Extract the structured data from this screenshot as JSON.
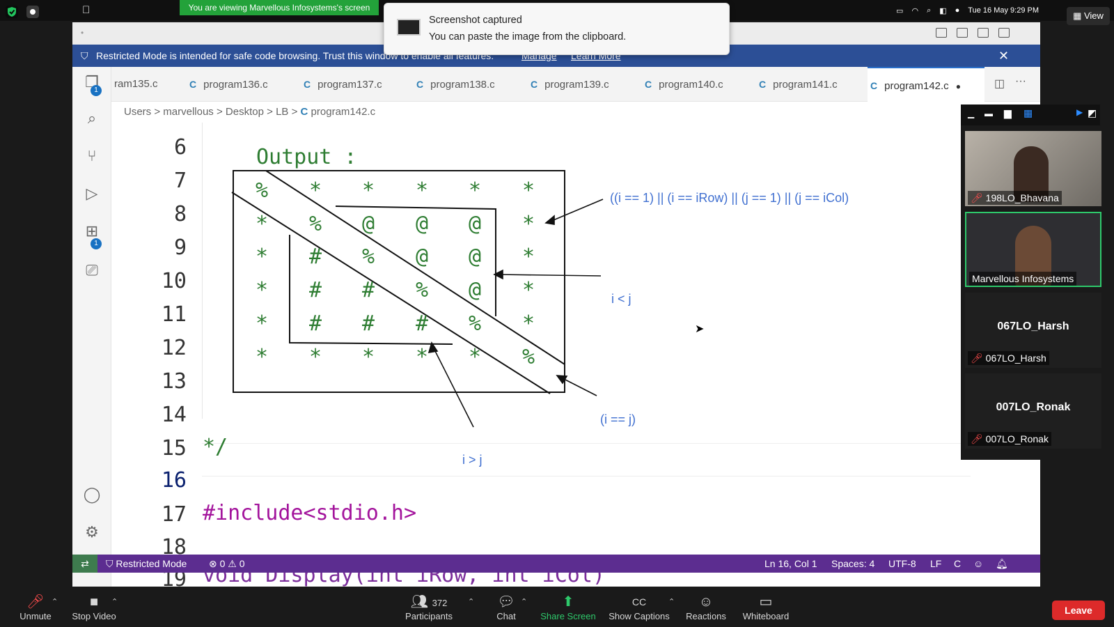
{
  "system_bar": {
    "share_banner": "You are viewing Marvellous Infosystems's screen",
    "datetime": "Tue 16 May  9:29 PM",
    "view_label": "View"
  },
  "toast": {
    "title": "Screenshot captured",
    "message": "You can paste the image from the clipboard."
  },
  "restricted_banner": {
    "text": "Restricted Mode is intended for safe code browsing. Trust this window to enable all features.",
    "manage": "Manage",
    "learn_more": "Learn More"
  },
  "activity_bar": {
    "explorer_badge": "1",
    "extensions_badge": "1"
  },
  "tabs": [
    {
      "label": "ram135.c"
    },
    {
      "label": "program136.c"
    },
    {
      "label": "program137.c"
    },
    {
      "label": "program138.c"
    },
    {
      "label": "program139.c"
    },
    {
      "label": "program140.c"
    },
    {
      "label": "program141.c"
    },
    {
      "label": "program142.c",
      "active": true,
      "modified": true
    }
  ],
  "tab_icon_letter": "C",
  "breadcrumb": [
    "Users",
    "marvellous",
    "Desktop",
    "LB",
    "program142.c"
  ],
  "editor": {
    "line_numbers": [
      "6",
      "7",
      "8",
      "9",
      "10",
      "11",
      "12",
      "13",
      "14",
      "15",
      "16",
      "17",
      "18",
      "19"
    ],
    "output_label": "Output :",
    "grid": [
      [
        "%",
        "*",
        "*",
        "*",
        "*",
        "*"
      ],
      [
        "*",
        "%",
        "@",
        "@",
        "@",
        "*"
      ],
      [
        "*",
        "#",
        "%",
        "@",
        "@",
        "*"
      ],
      [
        "*",
        "#",
        "#",
        "%",
        "@",
        "*"
      ],
      [
        "*",
        "#",
        "#",
        "#",
        "%",
        "*"
      ],
      [
        "*",
        "*",
        "*",
        "*",
        "*",
        "%"
      ]
    ],
    "annotations": {
      "border": "((i == 1) || (i == iRow) || (j == 1) || (j == iCol)",
      "upper": "i < j",
      "diag": "(i == j)",
      "lower": "i > j"
    },
    "comment_end": "*/",
    "include_line": "#include<stdio.h>",
    "partial_line": "void Display(int iRow, int iCol)"
  },
  "status_bar": {
    "restricted": "Restricted Mode",
    "errors": "0",
    "warnings": "0",
    "position": "Ln 16, Col 1",
    "spaces": "Spaces: 4",
    "encoding": "UTF-8",
    "eol": "LF",
    "language": "C"
  },
  "participants_panel": [
    {
      "name": "198LO_Bhavana",
      "muted": true,
      "video": true
    },
    {
      "name": "Marvellous Infosystems",
      "muted": false,
      "video": true,
      "active_speaker": true
    },
    {
      "name": "067LO_Harsh",
      "muted": true,
      "video": false
    },
    {
      "name": "007LO_Ronak",
      "muted": true,
      "video": false
    }
  ],
  "zoom_controls": {
    "unmute": "Unmute",
    "stop_video": "Stop Video",
    "participants": "Participants",
    "participant_count": "372",
    "chat": "Chat",
    "share_screen": "Share Screen",
    "show_captions": "Show Captions",
    "reactions": "Reactions",
    "whiteboard": "Whiteboard",
    "leave": "Leave"
  },
  "colors": {
    "restricted_banner": "#2c4f96",
    "status_bar": "#5c2d90",
    "share_banner": "#23a23a",
    "code_green": "#2e7d32",
    "annotation_blue": "#3f6fd0",
    "leave_red": "#dd2a2a"
  }
}
